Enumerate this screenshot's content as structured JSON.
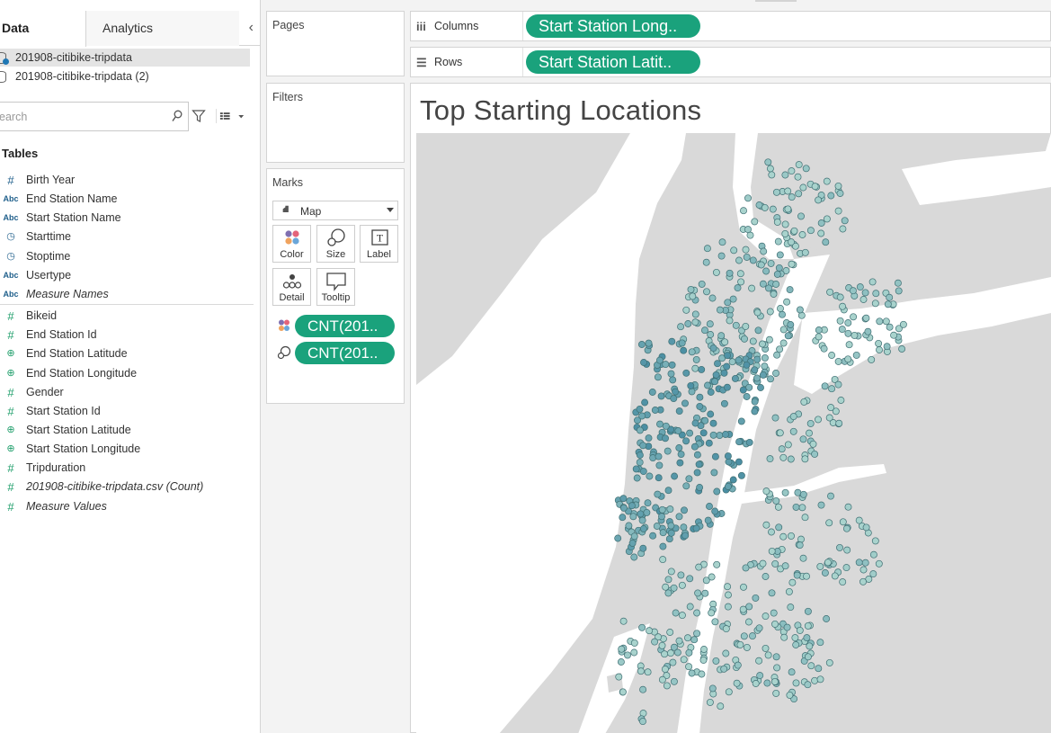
{
  "data_pane": {
    "tabs": [
      {
        "label": "Data",
        "active": true
      },
      {
        "label": "Analytics",
        "active": false
      }
    ],
    "collapse_icon": "chevron-left",
    "data_sources": [
      {
        "label": "201908-citibike-tripdata",
        "selected": true
      },
      {
        "label": "201908-citibike-tripdata (2)",
        "selected": false
      }
    ],
    "search": {
      "placeholder": "earch"
    },
    "tables_heading": "Tables",
    "fields": [
      {
        "label": "Birth Year",
        "type": "number",
        "icon": "hash-blue",
        "italic": false
      },
      {
        "label": "End Station Name",
        "type": "string",
        "icon": "abc",
        "italic": false
      },
      {
        "label": "Start Station Name",
        "type": "string",
        "icon": "abc",
        "italic": false
      },
      {
        "label": "Starttime",
        "type": "datetime",
        "icon": "calendar-clock",
        "italic": false
      },
      {
        "label": "Stoptime",
        "type": "datetime",
        "icon": "calendar-clock",
        "italic": false
      },
      {
        "label": "Usertype",
        "type": "string",
        "icon": "abc",
        "italic": false
      },
      {
        "label": "Measure Names",
        "type": "string",
        "icon": "abc",
        "italic": true
      },
      {
        "label": "Bikeid",
        "type": "number",
        "icon": "hash-green",
        "italic": false
      },
      {
        "label": "End Station Id",
        "type": "number",
        "icon": "hash-green",
        "italic": false
      },
      {
        "label": "End Station Latitude",
        "type": "geo",
        "icon": "globe",
        "italic": false
      },
      {
        "label": "End Station Longitude",
        "type": "geo",
        "icon": "globe",
        "italic": false
      },
      {
        "label": "Gender",
        "type": "number",
        "icon": "hash-green",
        "italic": false
      },
      {
        "label": "Start Station Id",
        "type": "number",
        "icon": "hash-green",
        "italic": false
      },
      {
        "label": "Start Station Latitude",
        "type": "geo",
        "icon": "globe",
        "italic": false
      },
      {
        "label": "Start Station Longitude",
        "type": "geo",
        "icon": "globe",
        "italic": false
      },
      {
        "label": "Tripduration",
        "type": "number",
        "icon": "hash-green",
        "italic": false
      },
      {
        "label": "201908-citibike-tripdata.csv (Count)",
        "type": "number",
        "icon": "hash-green",
        "italic": true
      },
      {
        "label": "Measure Values",
        "type": "number",
        "icon": "hash-green",
        "italic": true
      }
    ]
  },
  "cards": {
    "pages": "Pages",
    "filters": "Filters",
    "marks": {
      "title": "Marks",
      "mark_type": "Map",
      "buttons": {
        "color": "Color",
        "size": "Size",
        "label": "Label",
        "detail": "Detail",
        "tooltip": "Tooltip"
      },
      "pills": [
        {
          "encoding": "color",
          "label": "CNT(201.."
        },
        {
          "encoding": "size",
          "label": "CNT(201.."
        }
      ]
    }
  },
  "shelves": {
    "columns": {
      "label": "Columns",
      "pill": "Start Station Long.."
    },
    "rows": {
      "label": "Rows",
      "pill": "Start Station Latit.."
    }
  },
  "sheet": {
    "title": "Top Starting Locations"
  },
  "colors": {
    "pill_green": "#1aa27c",
    "mark_light": "#a9d3cd",
    "mark_dark": "#4a8ea3",
    "map_land": "#d9d9d9",
    "map_water": "#ffffff"
  }
}
